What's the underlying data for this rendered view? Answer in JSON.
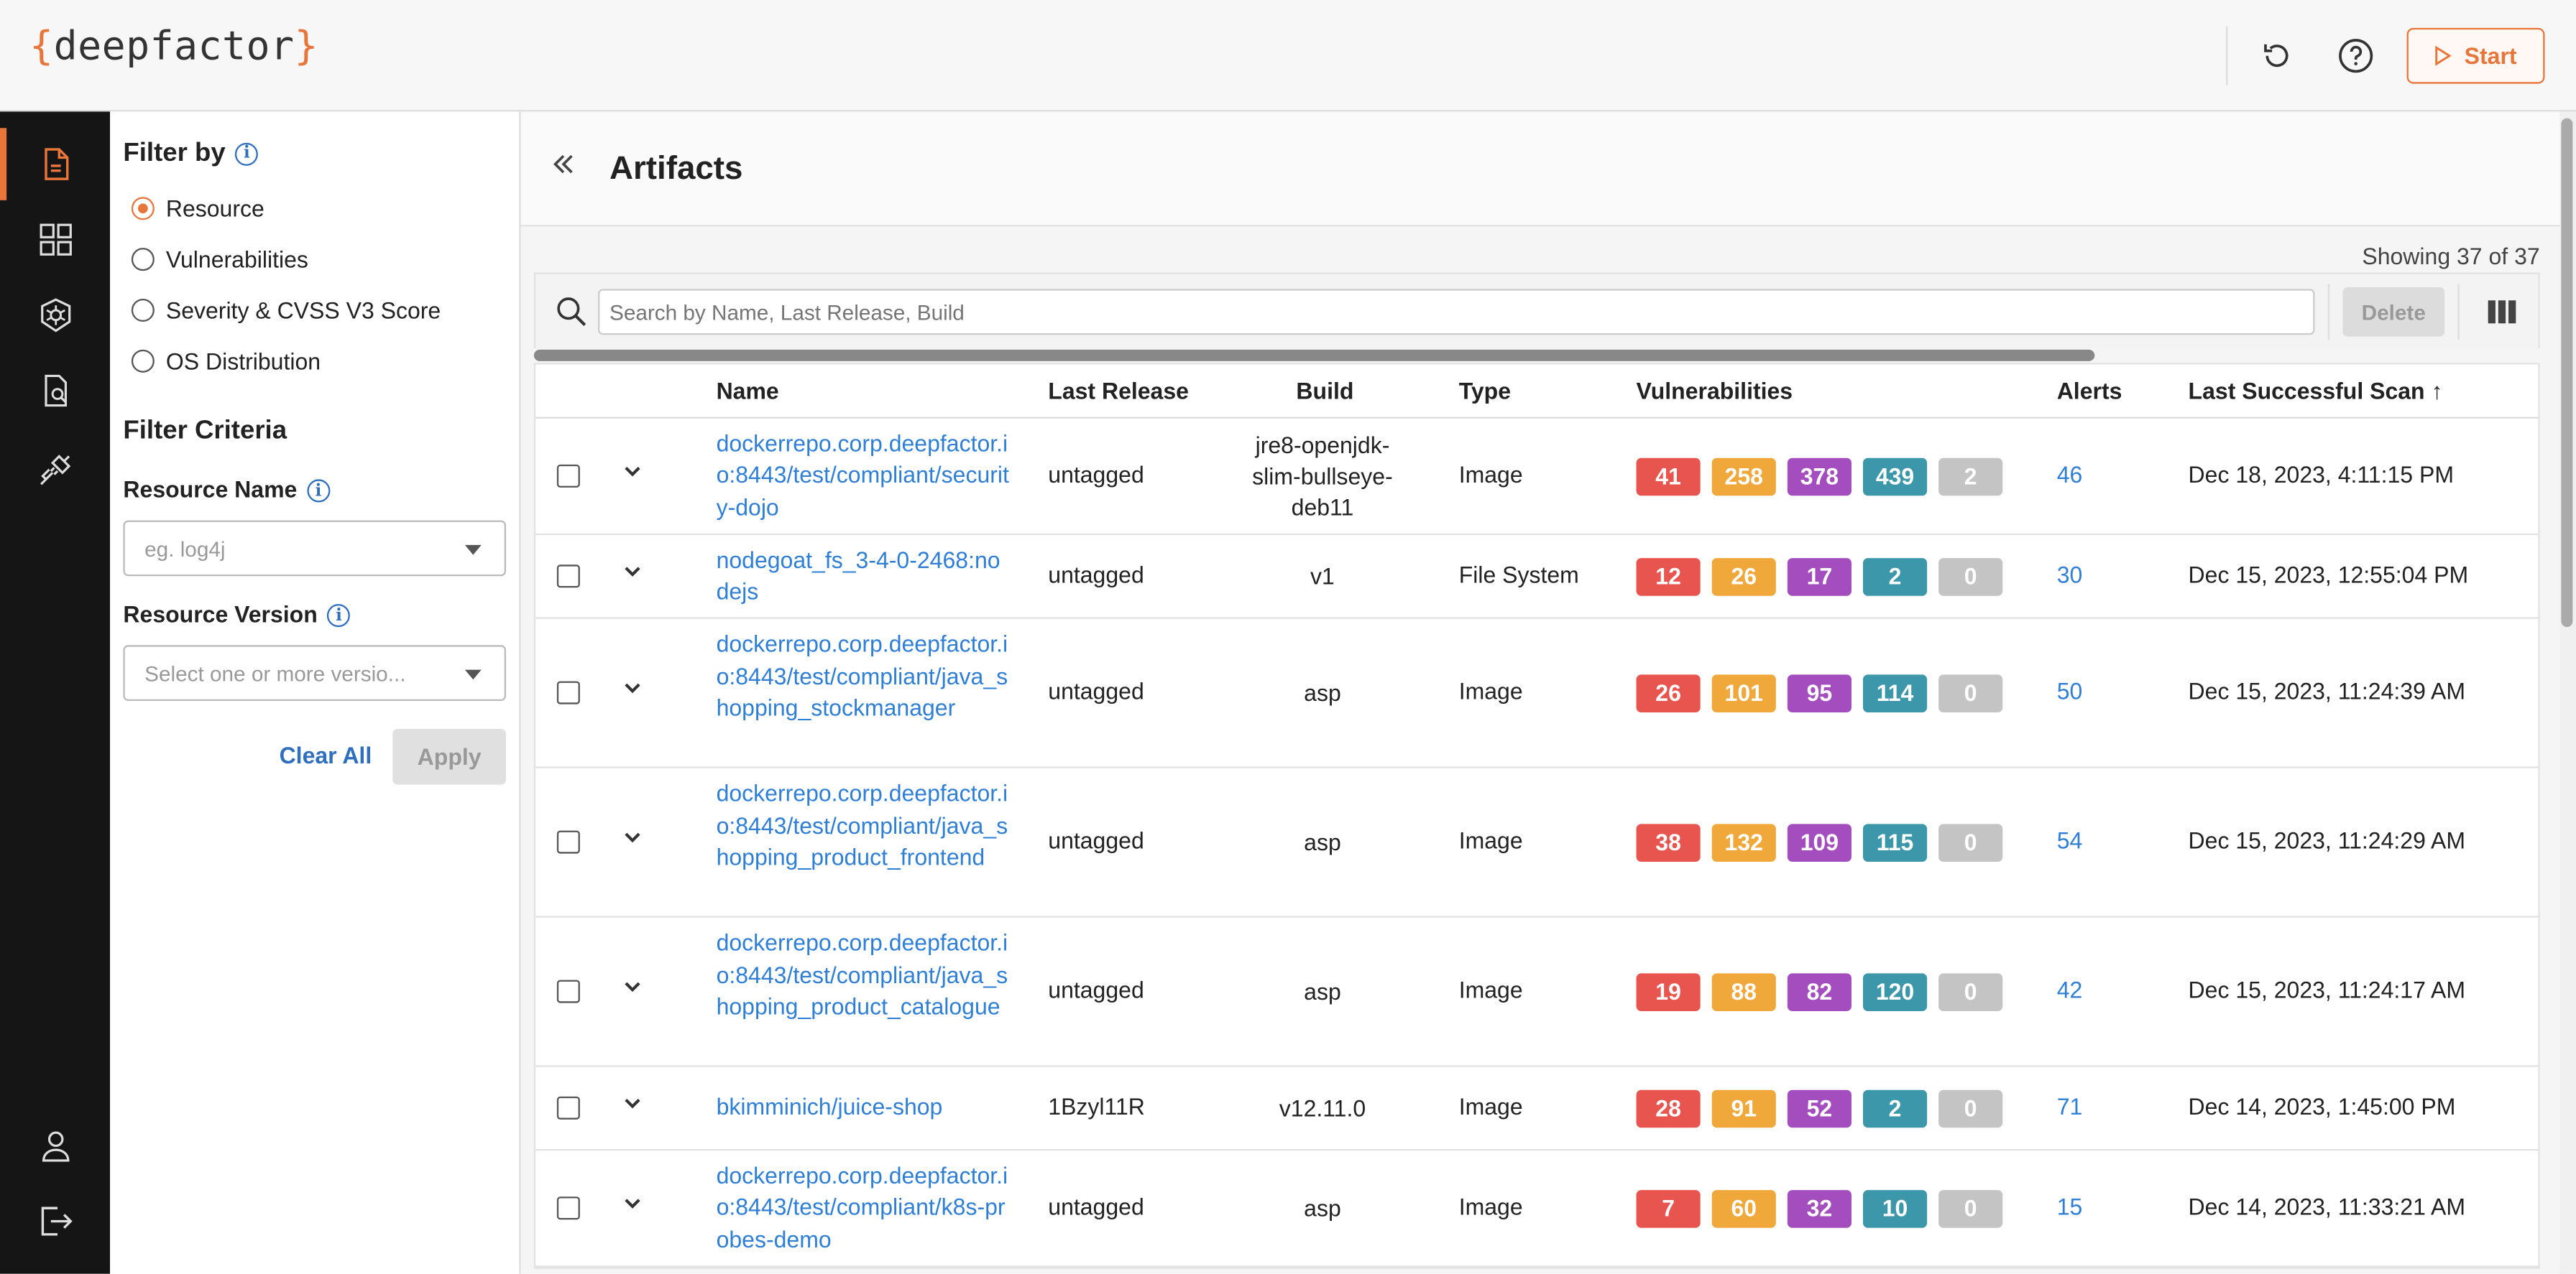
{
  "header": {
    "logo_text": "deepfactor",
    "start_label": "Start"
  },
  "colors": {
    "accent": "#e8763a",
    "link": "#2f7fd6",
    "critical": "#e8544e",
    "high": "#f0a83a",
    "medium": "#a34dbf",
    "low": "#3b97a9",
    "unknown": "#c4c4c4"
  },
  "filter": {
    "title": "Filter by",
    "options": [
      "Resource",
      "Vulnerabilities",
      "Severity & CVSS V3 Score",
      "OS Distribution"
    ],
    "selected": "Resource",
    "criteria_title": "Filter Criteria",
    "resource_name_label": "Resource Name",
    "resource_name_placeholder": "eg. log4j",
    "resource_version_label": "Resource Version",
    "resource_version_placeholder": "Select one or more versio...",
    "clear_label": "Clear All",
    "apply_label": "Apply"
  },
  "main": {
    "title": "Artifacts",
    "showing": "Showing 37 of 37",
    "search_placeholder": "Search by Name, Last Release, Build",
    "delete_label": "Delete",
    "columns": [
      "Name",
      "Last Release",
      "Build",
      "Type",
      "Vulnerabilities",
      "Alerts",
      "Last Successful Scan"
    ],
    "sort_indicator": "↑"
  },
  "rows": [
    {
      "name": "dockerrepo.corp.deepfactor.io:8443/test/compliant/security-dojo",
      "release": "untagged",
      "build": "jre8-openjdk-slim-bullseye-deb11",
      "type": "Image",
      "vulns": [
        "41",
        "258",
        "378",
        "439",
        "2"
      ],
      "alerts": "46",
      "scan": "Dec 18, 2023, 4:11:15 PM"
    },
    {
      "name": "nodegoat_fs_3-4-0-2468:nodejs",
      "release": "untagged",
      "build": "v1",
      "type": "File System",
      "vulns": [
        "12",
        "26",
        "17",
        "2",
        "0"
      ],
      "alerts": "30",
      "scan": "Dec 15, 2023, 12:55:04 PM"
    },
    {
      "name": "dockerrepo.corp.deepfactor.io:8443/test/compliant/java_shopping_stockmanager",
      "release": "untagged",
      "build": "asp",
      "type": "Image",
      "vulns": [
        "26",
        "101",
        "95",
        "114",
        "0"
      ],
      "alerts": "50",
      "scan": "Dec 15, 2023, 11:24:39 AM"
    },
    {
      "name": "dockerrepo.corp.deepfactor.io:8443/test/compliant/java_shopping_product_frontend",
      "release": "untagged",
      "build": "asp",
      "type": "Image",
      "vulns": [
        "38",
        "132",
        "109",
        "115",
        "0"
      ],
      "alerts": "54",
      "scan": "Dec 15, 2023, 11:24:29 AM"
    },
    {
      "name": "dockerrepo.corp.deepfactor.io:8443/test/compliant/java_shopping_product_catalogue",
      "release": "untagged",
      "build": "asp",
      "type": "Image",
      "vulns": [
        "19",
        "88",
        "82",
        "120",
        "0"
      ],
      "alerts": "42",
      "scan": "Dec 15, 2023, 11:24:17 AM"
    },
    {
      "name": "bkimminich/juice-shop",
      "release": "1Bzyl11R",
      "build": "v12.11.0",
      "type": "Image",
      "vulns": [
        "28",
        "91",
        "52",
        "2",
        "0"
      ],
      "alerts": "71",
      "scan": "Dec 14, 2023, 1:45:00 PM"
    },
    {
      "name": "dockerrepo.corp.deepfactor.io:8443/test/compliant/k8s-probes-demo",
      "release": "untagged",
      "build": "asp",
      "type": "Image",
      "vulns": [
        "7",
        "60",
        "32",
        "10",
        "0"
      ],
      "alerts": "15",
      "scan": "Dec 14, 2023, 11:33:21 AM"
    }
  ]
}
